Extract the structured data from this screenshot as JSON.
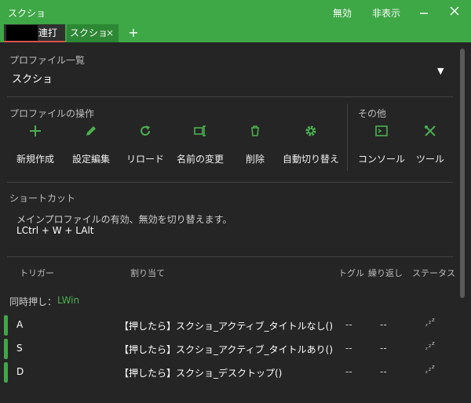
{
  "window": {
    "title": "スクショ",
    "disable_label": "無効",
    "hide_label": "非表示",
    "colors": {
      "accent": "#3ea746",
      "bg": "#252525"
    }
  },
  "tabs": [
    {
      "label": "連打"
    },
    {
      "label": "スクショ",
      "close": "×"
    }
  ],
  "tab_add": "+",
  "profile": {
    "section_label": "プロファイル一覧",
    "value": "スクショ",
    "arrow": "▼"
  },
  "operations": {
    "section_label": "プロファイルの操作",
    "actions": [
      {
        "label": "新規作成",
        "icon": "plus-icon"
      },
      {
        "label": "設定編集",
        "icon": "pencil-icon"
      },
      {
        "label": "リロード",
        "icon": "reload-icon"
      },
      {
        "label": "名前の変更",
        "icon": "rename-icon"
      },
      {
        "label": "削除",
        "icon": "trash-icon"
      },
      {
        "label": "自動切り替え",
        "icon": "gear-icon"
      }
    ]
  },
  "others": {
    "section_label": "その他",
    "actions": [
      {
        "label": "コンソール",
        "icon": "console-icon"
      },
      {
        "label": "ツール",
        "icon": "tools-icon"
      }
    ]
  },
  "shortcut": {
    "section_label": "ショートカット",
    "description": "メインプロファイルの有効、無効を切り替えます。",
    "keys": "LCtrl + W + LAlt"
  },
  "table": {
    "headers": {
      "trigger": "トリガー",
      "assign": "割り当て",
      "toggle": "トグル",
      "repeat": "繰り返し",
      "status": "ステータス"
    },
    "simul_label": "同時押し：",
    "simul_value": "LWin",
    "rows": [
      {
        "trigger": "A",
        "assign": "【押したら】スクショ_アクティブ_タイトルなし()",
        "toggle": "--",
        "repeat": "--",
        "status_icon": "sleep-icon"
      },
      {
        "trigger": "S",
        "assign": "【押したら】スクショ_アクティブ_タイトルあり()",
        "toggle": "--",
        "repeat": "--",
        "status_icon": "sleep-icon"
      },
      {
        "trigger": "D",
        "assign": "【押したら】スクショ_デスクトップ()",
        "toggle": "--",
        "repeat": "--",
        "status_icon": "sleep-icon"
      }
    ]
  }
}
